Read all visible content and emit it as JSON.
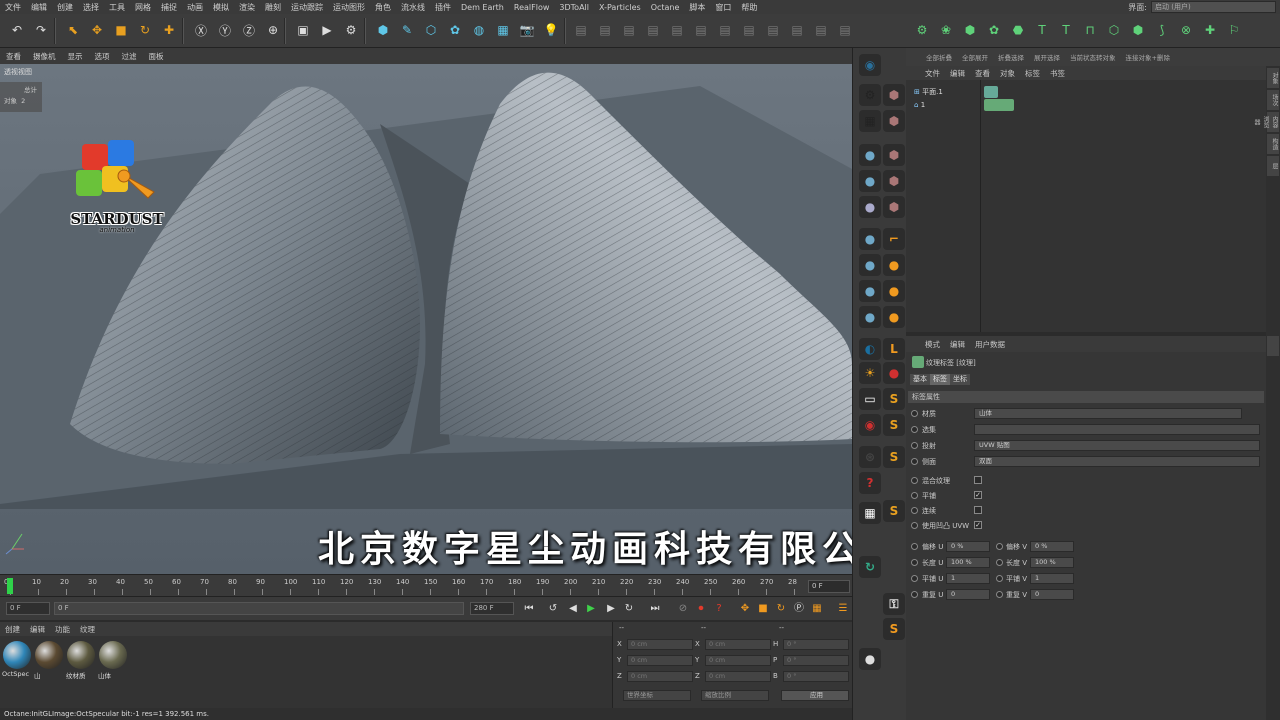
{
  "menu": [
    "文件",
    "编辑",
    "创建",
    "选择",
    "工具",
    "网格",
    "捕捉",
    "动画",
    "模拟",
    "渲染",
    "雕刻",
    "运动跟踪",
    "运动图形",
    "角色",
    "流水线",
    "插件",
    "Dem Earth",
    "RealFlow",
    "3DToAll",
    "X-Particles",
    "Octane",
    "脚本",
    "窗口",
    "帮助"
  ],
  "layout": {
    "label": "界面:",
    "value": "启动 (用户)"
  },
  "viewport_menu": [
    "查看",
    "摄像机",
    "显示",
    "选项",
    "过滤",
    "面板"
  ],
  "viewport": {
    "title": "透视视图",
    "stats_total": "总计",
    "stats_objects_label": "对象",
    "stats_objects_value": "2",
    "logo_text": "STARDUST",
    "logo_sub": "animation",
    "watermark": "北京数字星尘动画科技有限公司"
  },
  "timeline": {
    "ticks": [
      "0",
      "10",
      "20",
      "30",
      "40",
      "50",
      "60",
      "70",
      "80",
      "90",
      "100",
      "110",
      "120",
      "130",
      "140",
      "150",
      "160",
      "170",
      "180",
      "190",
      "200",
      "210",
      "220",
      "230",
      "240",
      "250",
      "260",
      "270",
      "28"
    ],
    "current_frame": "0 F",
    "start": "0 F",
    "range_start": "0 F",
    "range_end": "280 F",
    "end": "280 F"
  },
  "material_menu": [
    "创建",
    "编辑",
    "功能",
    "纹理"
  ],
  "materials": [
    {
      "label": "OctSpec",
      "color": "#2f86b8"
    },
    {
      "label": "山",
      "color": "#5b4a32"
    },
    {
      "label": "纹材质",
      "color": "#5d5a40"
    },
    {
      "label": "山体",
      "color": "#6a6a50"
    }
  ],
  "coords": {
    "header": [
      "--",
      "--",
      "--"
    ],
    "rows": [
      {
        "axis1": "X",
        "v1": "0 cm",
        "axis2": "X",
        "v2": "0 cm",
        "axis3": "H",
        "v3": "0 °"
      },
      {
        "axis1": "Y",
        "v1": "0 cm",
        "axis2": "Y",
        "v2": "0 cm",
        "axis3": "P",
        "v3": "0 °"
      },
      {
        "axis1": "Z",
        "v1": "0 cm",
        "axis2": "Z",
        "v2": "0 cm",
        "axis3": "B",
        "v3": "0 °"
      }
    ],
    "world": "世界坐标",
    "scale": "缩放比例",
    "apply": "应用"
  },
  "status": "Octane:InitGLImage:OctSpecular  bit:-1 res=1  392.561 ms.",
  "object_top": [
    "全部折叠",
    "全部展开",
    "折叠选择",
    "展开选择",
    "当前状态转对象",
    "连接对象+删除"
  ],
  "object_menu": [
    "文件",
    "编辑",
    "查看",
    "对象",
    "标签",
    "书签"
  ],
  "objects": [
    {
      "name": "平面.1"
    },
    {
      "name": "1"
    }
  ],
  "side_tabs": [
    "对象",
    "场次",
    "内容浏览器",
    "构造",
    "层"
  ],
  "attr_menu": [
    "模式",
    "编辑",
    "用户数据"
  ],
  "attr": {
    "title": "纹理标签 [纹理]",
    "tabs": [
      "基本",
      "标签",
      "坐标"
    ],
    "section": "标签属性",
    "material_label": "材质",
    "material_value": "山体",
    "selection_label": "选集",
    "selection_value": "",
    "projection_label": "投射",
    "projection_value": "UVW 贴图",
    "side_label": "侧面",
    "side_value": "双面",
    "mix_label": "混合纹理",
    "tile_label": "平铺",
    "seamless_label": "连续",
    "uvw_label": "使用凹凸 UVW",
    "offset_u_label": "偏移 U",
    "offset_u_value": "0 %",
    "offset_v_label": "偏移 V",
    "offset_v_value": "0 %",
    "length_u_label": "长度 U",
    "length_u_value": "100 %",
    "length_v_label": "长度 V",
    "length_v_value": "100 %",
    "tiles_u_label": "平铺 U",
    "tiles_u_value": "1",
    "tiles_v_label": "平铺 V",
    "tiles_v_value": "1",
    "repeat_u_label": "重复 U",
    "repeat_u_value": "0",
    "repeat_v_label": "重复 V",
    "repeat_v_value": "0"
  },
  "icons": {
    "toolbar": [
      "undo-icon",
      "redo-icon",
      "select-icon",
      "move-icon",
      "scale-icon",
      "rotate-icon",
      "add-icon",
      "x-axis-icon",
      "y-axis-icon",
      "z-axis-icon",
      "world-coord-icon",
      "render-view-icon",
      "render-icon",
      "render-settings-icon",
      "cube-icon",
      "pen-icon",
      "subdivision-icon",
      "array-icon",
      "deformer-icon",
      "floor-icon",
      "camera-icon",
      "light-icon"
    ],
    "accent": "#e8a020"
  }
}
